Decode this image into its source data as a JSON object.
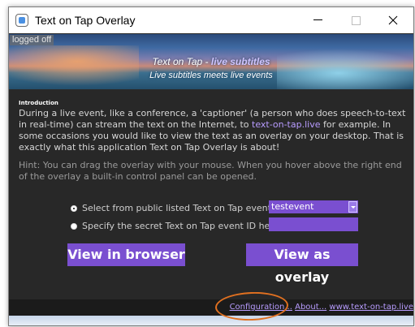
{
  "window": {
    "title": "Text on Tap Overlay",
    "controls": {
      "minimize": "minimize",
      "maximize": "maximize",
      "close": "close"
    }
  },
  "status": {
    "text": "logged off"
  },
  "banner": {
    "title_plain": "Text on Tap - ",
    "title_highlight": "live subtitles",
    "subtitle": "Live subtitles meets live events"
  },
  "intro": {
    "heading": "Introduction",
    "para1_before_link": "During a live event, like a conference, a 'captioner' (a person who does speech-to-text in real-time) can stream the text on the Internet, to ",
    "para1_link": "text-on-tap.live",
    "para1_after_link": " for example. In some occasions you would like to view the text as an overlay on your desktop. That is exactly what this application Text on Tap Overlay is about!",
    "hint": "Hint: You can drag the overlay with your mouse. When you hover above the right end of the overlay a built-in control panel can be opened."
  },
  "options": {
    "public_label": "Select from public listed Text on Tap events:",
    "public_selected": "testevent",
    "secret_label": "Specify the secret Text on Tap event ID here:",
    "secret_value": ""
  },
  "buttons": {
    "view_browser": "View in browser",
    "view_overlay": "View as overlay"
  },
  "footer": {
    "configuration": "Configuration...",
    "about": "About...",
    "site": "www.text-on-tap.live"
  },
  "colors": {
    "accent": "#7a4fd0",
    "link": "#b89cff",
    "background": "#282828",
    "annotation": "#e07020"
  }
}
